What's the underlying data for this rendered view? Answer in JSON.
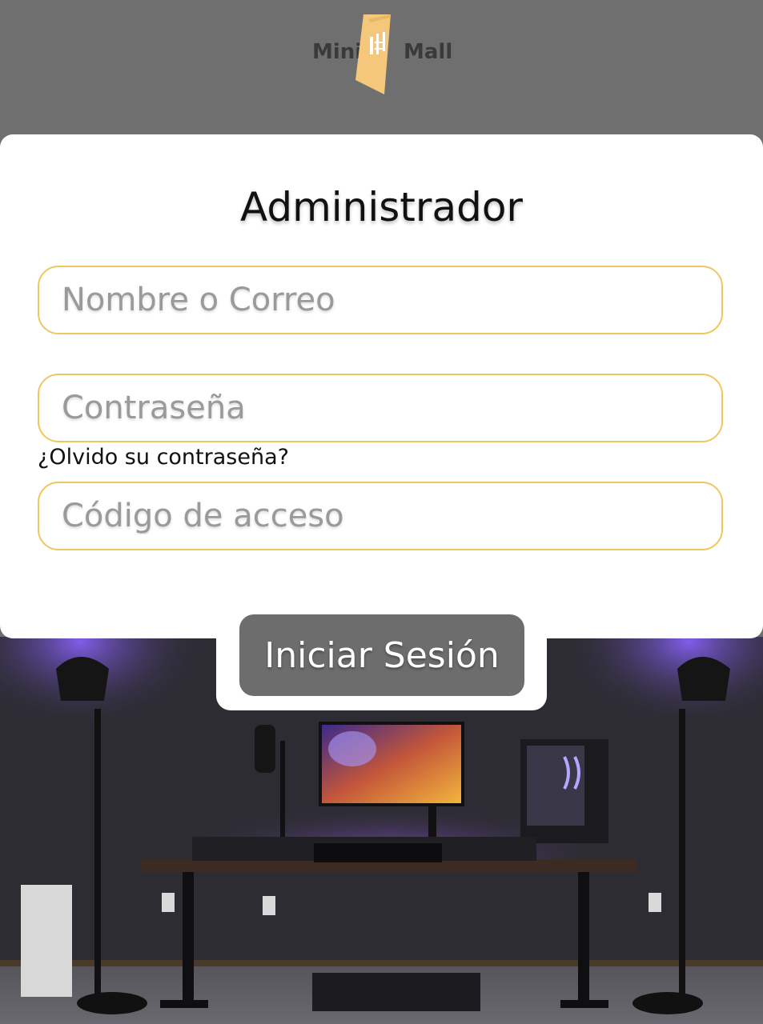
{
  "brand": {
    "left_word": "Mini",
    "right_word": "Mall",
    "logo_color": "#f4c77a"
  },
  "login": {
    "title": "Administrador",
    "username_placeholder": "Nombre o Correo",
    "password_placeholder": "Contraseña",
    "forgot_label": "¿Olvido su contraseña?",
    "access_code_placeholder": "Código de acceso",
    "submit_label": "Iniciar Sesión"
  },
  "colors": {
    "accent_border": "#f0c75e",
    "button_bg": "#6d6d6d",
    "header_bg": "#6f6f6f",
    "ambient_light": "#7a4dff"
  }
}
